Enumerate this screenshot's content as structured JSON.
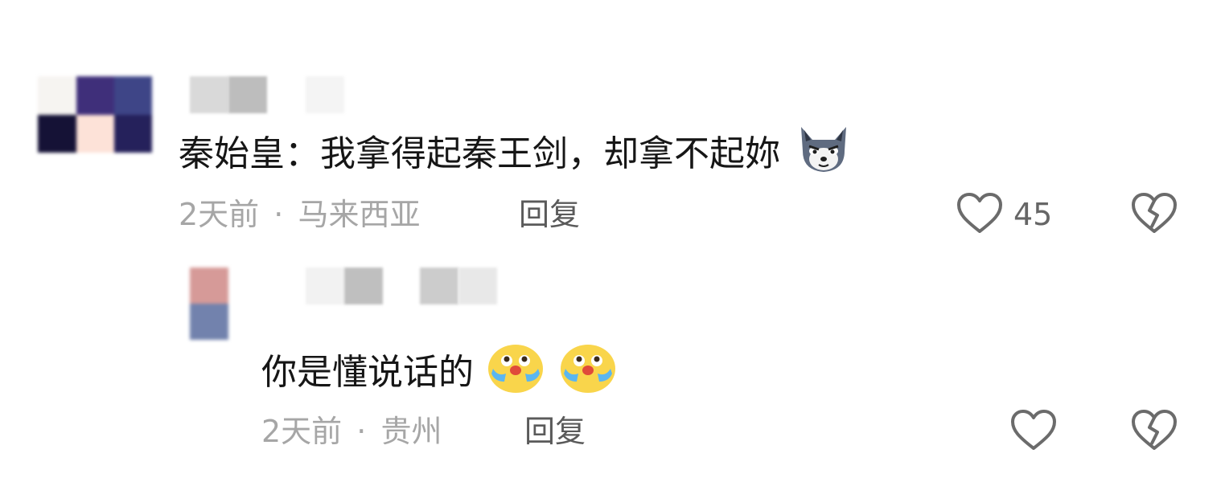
{
  "comments": [
    {
      "text": "秦始皇：我拿得起秦王剑，却拿不起妳",
      "emoji": "wolf-face-emoji",
      "time": "2天前",
      "separator": "·",
      "location": "马来西亚",
      "reply_label": "回复",
      "likes": "45"
    },
    {
      "text": "你是懂说话的",
      "emoji": "crying-laughing-emoji",
      "time": "2天前",
      "separator": "·",
      "location": "贵州",
      "reply_label": "回复",
      "likes": ""
    }
  ],
  "colors": {
    "text": "#161616",
    "meta": "#a6a6a6",
    "reply": "#5a5a5a",
    "icon": "#6b6b6b"
  }
}
